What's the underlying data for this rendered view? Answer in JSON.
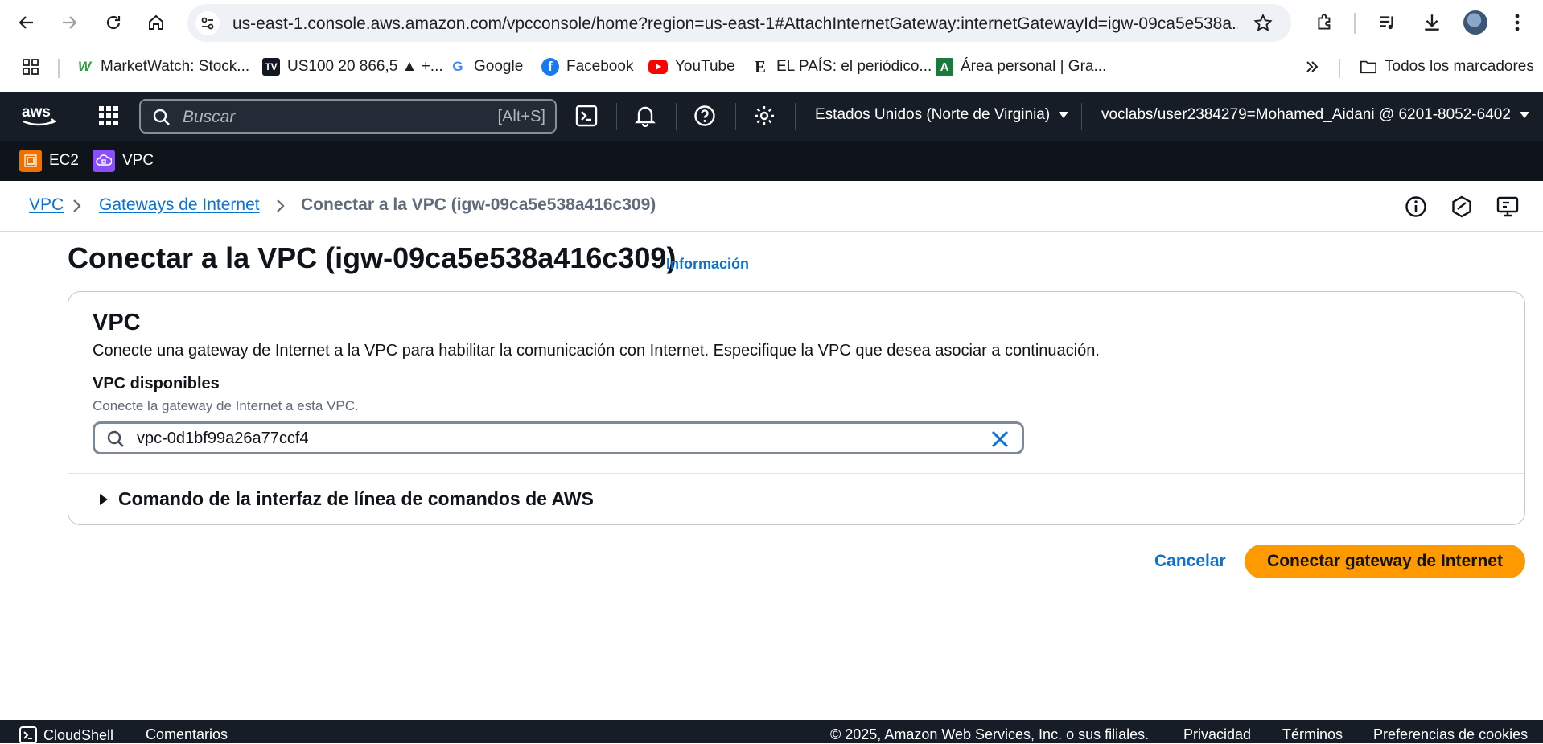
{
  "browser": {
    "url": "us-east-1.console.aws.amazon.com/vpcconsole/home?region=us-east-1#AttachInternetGateway:internetGatewayId=igw-09ca5e538a...",
    "bookmarks": [
      {
        "label": "MarketWatch: Stock...",
        "icon": "marketwatch-icon",
        "color": "#2e9c3f"
      },
      {
        "label": "US100 20 866,5 ▲ +...",
        "icon": "tradingview-icon",
        "color": "#131722"
      },
      {
        "label": "Google",
        "icon": "google-icon",
        "color": "#4285f4"
      },
      {
        "label": "Facebook",
        "icon": "facebook-icon",
        "color": "#1877f2"
      },
      {
        "label": "YouTube",
        "icon": "youtube-icon",
        "color": "#ff0000"
      },
      {
        "label": "EL PAÍS: el periódico...",
        "icon": "elpais-icon",
        "color": "#111111"
      },
      {
        "label": "Área personal | Gra...",
        "icon": "area-personal-icon",
        "color": "#1a7a3c"
      }
    ],
    "all_bookmarks": "Todos los marcadores"
  },
  "aws": {
    "search_placeholder": "Buscar",
    "search_shortcut": "[Alt+S]",
    "region": "Estados Unidos (Norte de Virginia)",
    "account": "voclabs/user2384279=Mohamed_Aidani @ 6201-8052-6402",
    "services": [
      {
        "label": "EC2",
        "color": "#ed7100"
      },
      {
        "label": "VPC",
        "color": "#8c4fff"
      }
    ]
  },
  "breadcrumb": {
    "items": [
      "VPC",
      "Gateways de Internet"
    ],
    "current": "Conectar a la VPC (igw-09ca5e538a416c309)"
  },
  "page": {
    "title": "Conectar a la VPC (igw-09ca5e538a416c309)",
    "info": "Información"
  },
  "panel": {
    "title": "VPC",
    "description": "Conecte una gateway de Internet a la VPC para habilitar la comunicación con Internet. Especifique la VPC que desea asociar a continuación.",
    "field_label": "VPC disponibles",
    "field_description": "Conecte la gateway de Internet a esta VPC.",
    "field_value": "vpc-0d1bf99a26a77ccf4",
    "cli_toggle": "Comando de la interfaz de línea de comandos de AWS"
  },
  "actions": {
    "cancel": "Cancelar",
    "attach": "Conectar gateway de Internet"
  },
  "footer": {
    "cloudshell": "CloudShell",
    "feedback": "Comentarios",
    "copyright": "© 2025, Amazon Web Services, Inc. o sus filiales.",
    "privacy": "Privacidad",
    "terms": "Términos",
    "cookies": "Preferencias de cookies"
  }
}
